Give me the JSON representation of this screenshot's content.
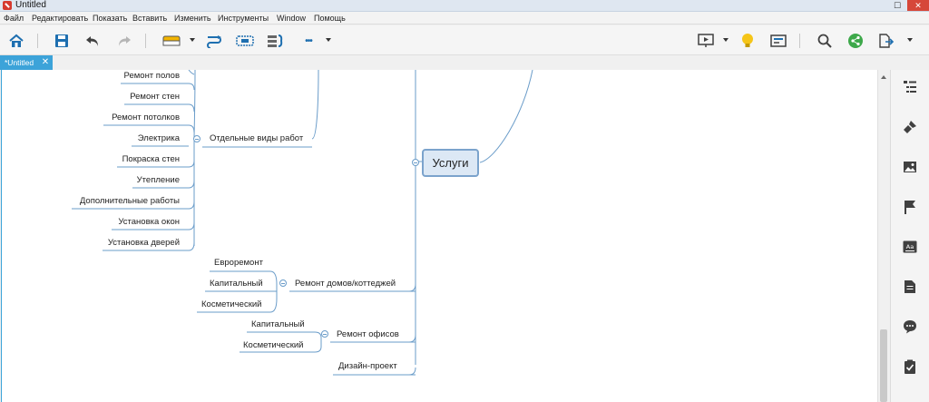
{
  "window": {
    "title": "Untitled",
    "close_glyph": "✕",
    "maximize_glyph": "☐"
  },
  "menu": [
    "Файл",
    "Редактировать",
    "Показать",
    "Вставить",
    "Изменить",
    "Инструменты",
    "Window",
    "Помощь"
  ],
  "tab": {
    "label": "*Untitled",
    "close_glyph": "✕"
  },
  "toolbar": {
    "icons": [
      "home-icon",
      "save-icon",
      "undo-icon",
      "redo-icon",
      "topic-icon",
      "relationship-icon",
      "boundary-icon",
      "summary-icon",
      "more-icon",
      "presentation-icon",
      "idea-icon",
      "outline-icon",
      "search-icon",
      "share-icon",
      "export-icon"
    ],
    "more_glyph": "•••"
  },
  "mindmap": {
    "central": "Услуги",
    "branches": {
      "separate_works": {
        "label": "Отдельные виды работ",
        "items": [
          "Ремонт полов",
          "Ремонт стен",
          "Ремонт потолков",
          "Электрика",
          "Покраска стен",
          "Утепление",
          "Дополнительные работы",
          "Установка окон",
          "Установка дверей"
        ]
      },
      "houses": {
        "label": "Ремонт домов/коттеджей",
        "items": [
          "Евроремонт",
          "Капитальный",
          "Косметический"
        ]
      },
      "offices": {
        "label": "Ремонт офисов",
        "items": [
          "Капитальный",
          "Косметический"
        ]
      },
      "design": {
        "label": "Дизайн-проект"
      }
    }
  },
  "right_panel": {
    "icons": [
      "outline-list-icon",
      "format-brush-icon",
      "image-icon",
      "flag-icon",
      "text-style-icon",
      "notes-icon",
      "comment-icon",
      "task-icon"
    ]
  },
  "colors": {
    "accent": "#3ca3d9",
    "line": "#6a9cc9",
    "topic_fill": "#dce8f5",
    "topic_border": "#7ba3cc",
    "icon_blue": "#1e6fb0",
    "icon_dark": "#404040"
  }
}
